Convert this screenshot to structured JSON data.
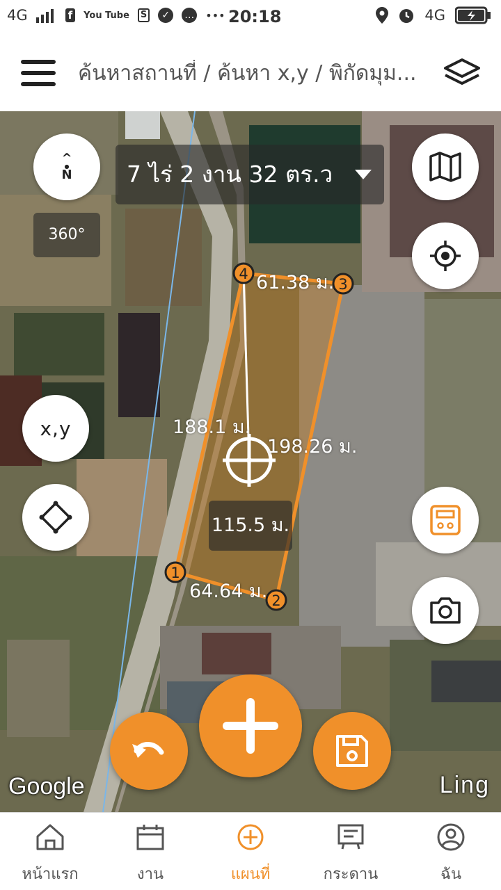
{
  "status_bar": {
    "network_left": "4G",
    "time": "20:18",
    "network_right": "4G",
    "icons_left": [
      "signal-icon",
      "facebook-icon",
      "youtube-icon",
      "screenshot-icon",
      "check-icon",
      "chat-icon",
      "more-icon"
    ],
    "icons_right": [
      "location-icon",
      "alarm-icon",
      "battery-icon"
    ],
    "youtube_label": "You Tube",
    "more": "•••"
  },
  "app_bar": {
    "title": "ค้นหาสถานที่ / ค้นหา x,y / พิกัดมุม..."
  },
  "map": {
    "area_text": "7 ไร่ 2 งาน 32 ตร.ว",
    "compass_n": "N",
    "rotation_label": "360°",
    "xy_button": "x,y",
    "measurements": {
      "top_side": "61.38 ม.",
      "left_side": "188.1 ม.",
      "right_side": "198.26 ม.",
      "bottom_side": "64.64 ม.",
      "center_line": "115.5 ม."
    },
    "vertices": [
      "1",
      "2",
      "3",
      "4"
    ],
    "google_logo": "Google",
    "ling_logo": "Ling"
  },
  "colors": {
    "accent": "#f0902a",
    "polygon_fill": "rgba(200,120,20,0.38)",
    "polygon_stroke": "#f0902a"
  },
  "bottom_nav": {
    "items": [
      {
        "label": "หน้าแรก",
        "icon": "home-icon",
        "active": false
      },
      {
        "label": "งาน",
        "icon": "calendar-icon",
        "active": false
      },
      {
        "label": "แผนที่",
        "icon": "add-circle-icon",
        "active": true
      },
      {
        "label": "กระดาน",
        "icon": "board-icon",
        "active": false
      },
      {
        "label": "ฉัน",
        "icon": "user-icon",
        "active": false
      }
    ]
  }
}
